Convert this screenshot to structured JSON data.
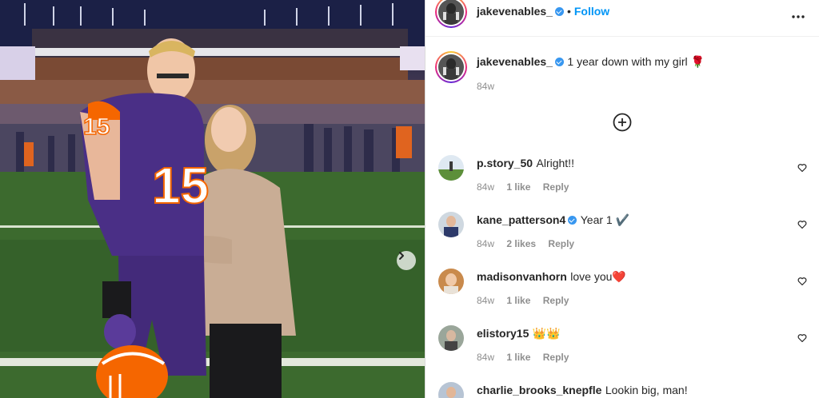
{
  "post": {
    "username": "jakevenables_",
    "follow_label": "Follow",
    "dot": "•",
    "more_label": "•••",
    "caption_text": "1 year down with my girl 🌹",
    "caption_time": "84w"
  },
  "comments": [
    {
      "username": "p.story_50",
      "verified": false,
      "text": "Alright!!",
      "time": "84w",
      "likes": "1 like",
      "reply": "Reply"
    },
    {
      "username": "kane_patterson4",
      "verified": true,
      "text": "Year 1 ✔️",
      "time": "84w",
      "likes": "2 likes",
      "reply": "Reply"
    },
    {
      "username": "madisonvanhorn",
      "verified": false,
      "text": "love you❤️",
      "time": "84w",
      "likes": "1 like",
      "reply": "Reply"
    },
    {
      "username": "elistory15",
      "verified": false,
      "text": "👑👑",
      "time": "84w",
      "likes": "1 like",
      "reply": "Reply"
    },
    {
      "username": "charlie_brooks_knepfle",
      "verified": false,
      "text": "Lookin big, man!",
      "time": "",
      "likes": "",
      "reply": ""
    }
  ],
  "photo": {
    "jersey_number": "15"
  },
  "colors": {
    "link_blue": "#0095f6",
    "verified_blue": "#3897f0",
    "text_primary": "#262626",
    "text_secondary": "#8e8e8e",
    "clemson_orange": "#f56600",
    "clemson_purple": "#522d80"
  }
}
